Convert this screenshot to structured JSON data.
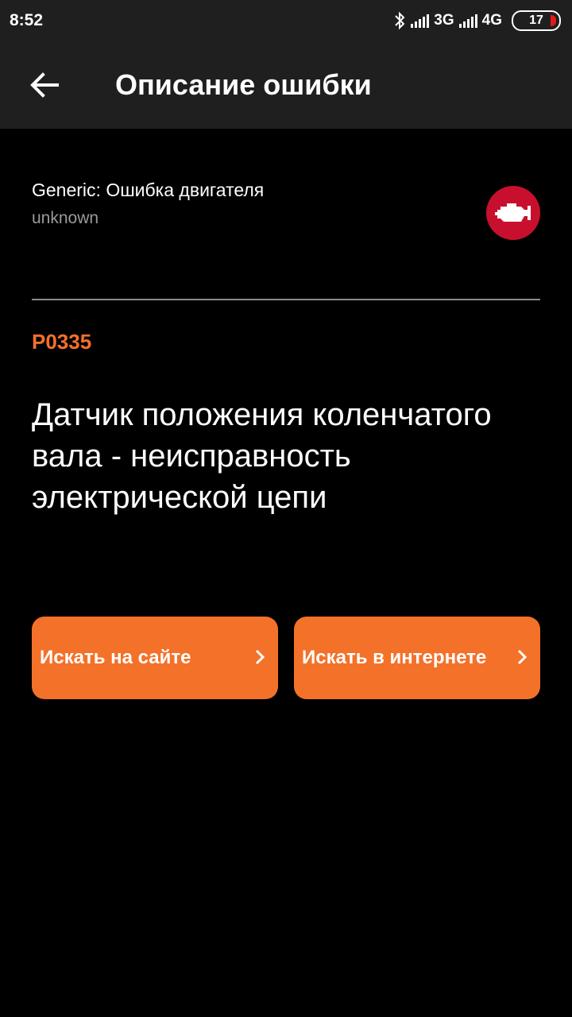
{
  "status_bar": {
    "time": "8:52",
    "network_1": "3G",
    "network_2": "4G",
    "battery": "17",
    "icons": [
      "bluetooth-icon",
      "signal-icon",
      "battery-icon"
    ]
  },
  "app_bar": {
    "title": "Описание ошибки",
    "back_icon": "arrow-left-icon"
  },
  "error": {
    "make": "Generic: Ошибка двигателя",
    "subtitle": "unknown",
    "badge_icon": "check-engine-icon",
    "code": "P0335",
    "description": "Датчик положения коленчатого вала - неисправность электрической цепи"
  },
  "actions": {
    "search_site": "Искать на сайте",
    "search_web": "Искать в интернете",
    "chevron_icon": "chevron-right-icon"
  },
  "colors": {
    "accent": "#f47129",
    "badge": "#c8102e",
    "bar_background": "#1f1f1f",
    "background": "#000000"
  }
}
